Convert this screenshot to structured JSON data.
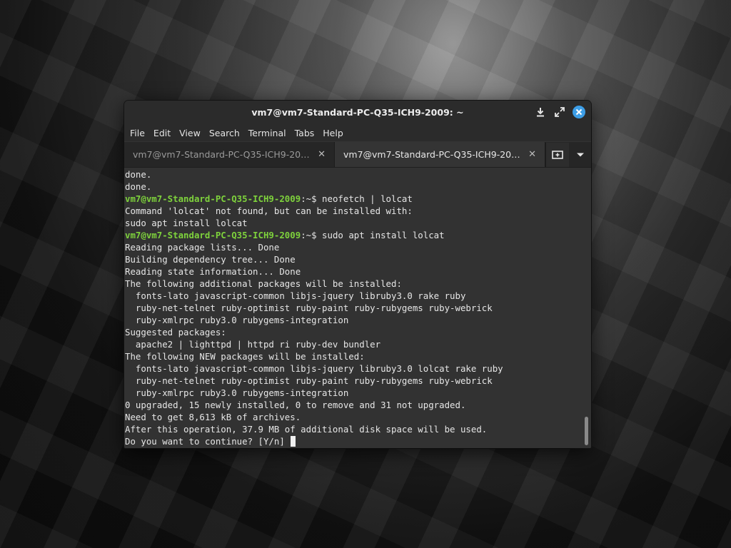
{
  "window": {
    "title": "vm7@vm7-Standard-PC-Q35-ICH9-2009: ~"
  },
  "menu": [
    "File",
    "Edit",
    "View",
    "Search",
    "Terminal",
    "Tabs",
    "Help"
  ],
  "tabs": [
    {
      "label": "vm7@vm7-Standard-PC-Q35-ICH9-200…",
      "active": false
    },
    {
      "label": "vm7@vm7-Standard-PC-Q35-ICH9-200…",
      "active": true
    }
  ],
  "terminal": {
    "prompt_user": "vm7@vm7-Standard-PC-Q35-ICH9-2009",
    "prompt_suffix": ":~$ ",
    "lines": [
      {
        "text": "done."
      },
      {
        "text": "done."
      },
      {
        "prompt": true,
        "text": "neofetch | lolcat"
      },
      {
        "text": "Command 'lolcat' not found, but can be installed with:"
      },
      {
        "text": "sudo apt install lolcat"
      },
      {
        "prompt": true,
        "text": "sudo apt install lolcat"
      },
      {
        "text": "Reading package lists... Done"
      },
      {
        "text": "Building dependency tree... Done"
      },
      {
        "text": "Reading state information... Done"
      },
      {
        "text": "The following additional packages will be installed:"
      },
      {
        "text": "  fonts-lato javascript-common libjs-jquery libruby3.0 rake ruby"
      },
      {
        "text": "  ruby-net-telnet ruby-optimist ruby-paint ruby-rubygems ruby-webrick"
      },
      {
        "text": "  ruby-xmlrpc ruby3.0 rubygems-integration"
      },
      {
        "text": "Suggested packages:"
      },
      {
        "text": "  apache2 | lighttpd | httpd ri ruby-dev bundler"
      },
      {
        "text": "The following NEW packages will be installed:"
      },
      {
        "text": "  fonts-lato javascript-common libjs-jquery libruby3.0 lolcat rake ruby"
      },
      {
        "text": "  ruby-net-telnet ruby-optimist ruby-paint ruby-rubygems ruby-webrick"
      },
      {
        "text": "  ruby-xmlrpc ruby3.0 rubygems-integration"
      },
      {
        "text": "0 upgraded, 15 newly installed, 0 to remove and 31 not upgraded."
      },
      {
        "text": "Need to get 8,613 kB of archives."
      },
      {
        "text": "After this operation, 37.9 MB of additional disk space will be used."
      },
      {
        "text": "Do you want to continue? [Y/n] ",
        "cursor": true
      }
    ]
  },
  "colors": {
    "prompt_user": "#7ed23c",
    "close_button": "#3d9ee6",
    "terminal_bg": "#323232"
  },
  "icons": {
    "download": "download-icon",
    "maximize": "maximize-icon",
    "close": "close-icon",
    "new_tab": "new-tab-icon",
    "tab_menu": "chevron-down-icon"
  }
}
